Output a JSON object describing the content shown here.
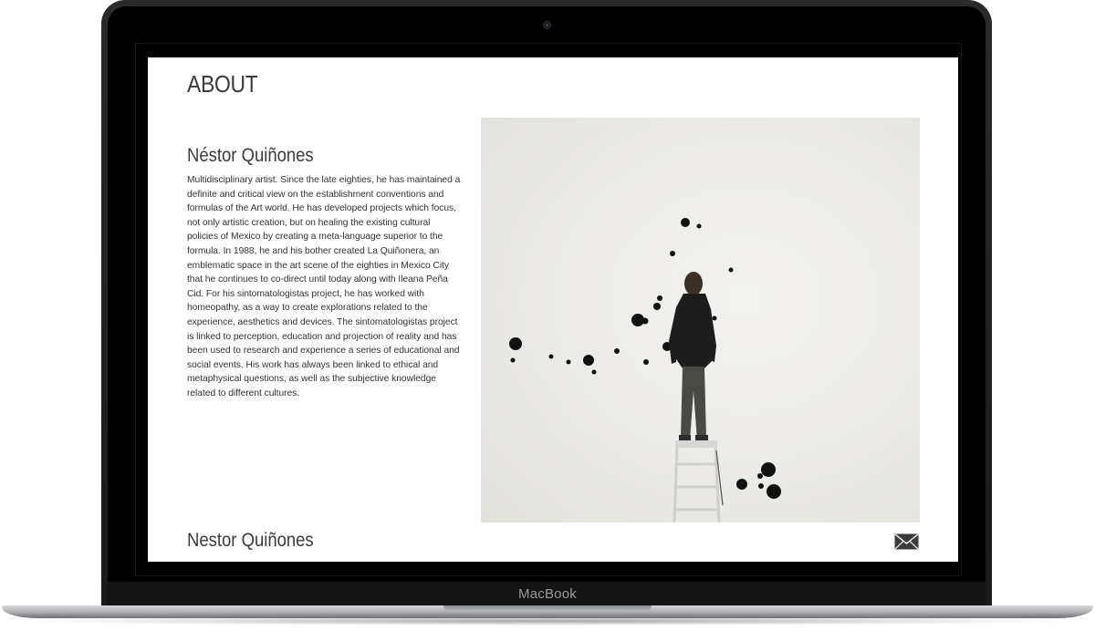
{
  "device": {
    "brand_label": "MacBook"
  },
  "page": {
    "title": "ABOUT",
    "artist": {
      "name": "Néstor Quiñones",
      "bio": "Multidisciplinary artist. Since the late eighties, he has maintained a definite and critical view on the establishment conventions and formulas of the Art world. He has developed projects which focus, not only artistic creation, but on healing the existing cultural policies of Mexico by creating a meta-language superior to the formula. In 1988, he and his bother created La Quiñonera, an emblematic space in the art scene of the eighties in Mexico City that he continues to co-direct until today along with Ileana Peña Cid. For his sintomatologistas project, he has worked with homeopathy, as a way to create explorations related to the experience, aesthetics and devices. The sintomatologistas project is linked to perception, education and projection of reality and has been used to research and experience a series of educational and social events. His work has always been linked to ethical and metaphysical questions, as well as the subjective knowledge related to different cultures."
    },
    "footer": {
      "name": "Nestor Quiñones",
      "contact_icon": "envelope-icon"
    }
  },
  "colors": {
    "text": "#3c3c3c",
    "screen_bg": "#ffffff",
    "bezel": "#000000",
    "photo_wall": "#ecebe7"
  }
}
